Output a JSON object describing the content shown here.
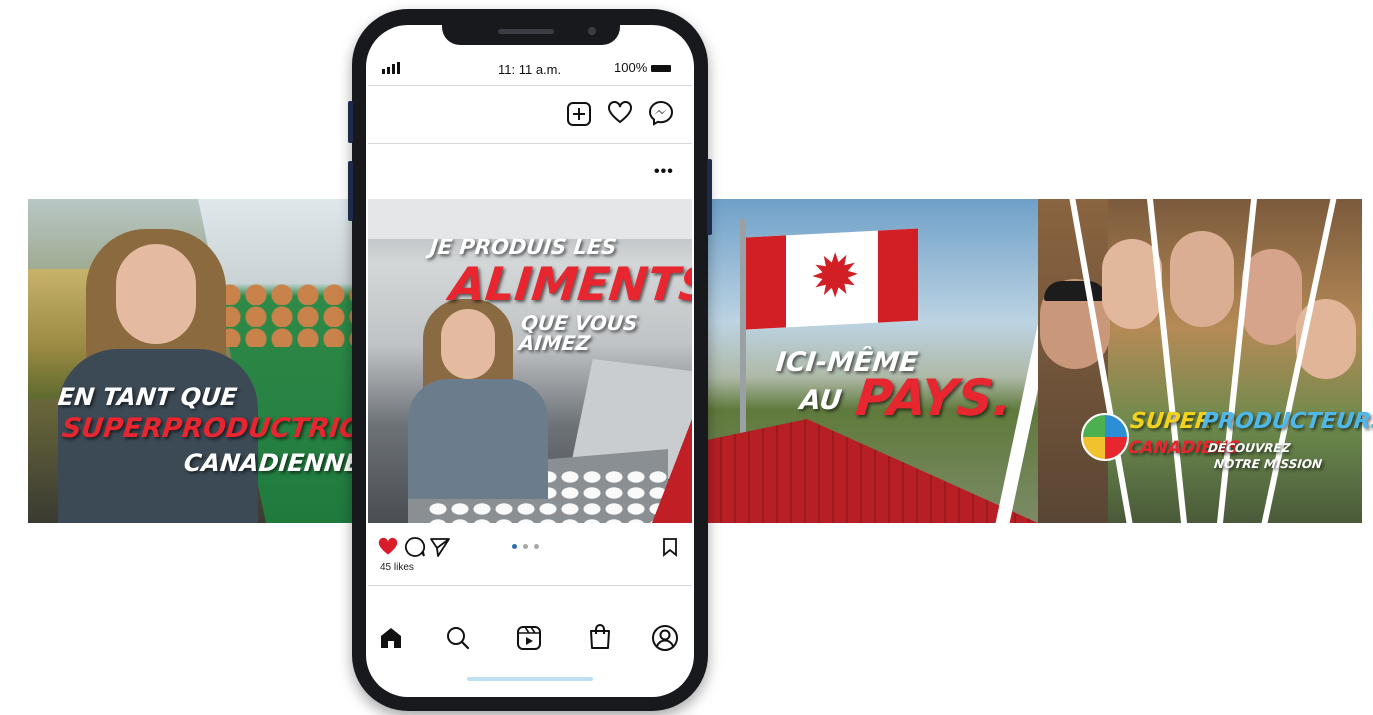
{
  "panels": {
    "left": {
      "line1": "EN TANT QUE",
      "line2": "SUPERPRODUCTRICE",
      "line3": "CANADIENNE"
    },
    "flag": {
      "line1": "ICI-MÊME",
      "line2": "AU",
      "line3": "PAYS."
    },
    "right": {
      "brand1": "SUPER",
      "brand2": "PRODUCTEURS",
      "brand3": "CANADIENS",
      "cta1": "DÉCOUVREZ",
      "cta2": "NOTRE MISSION"
    }
  },
  "phone": {
    "status": {
      "time": "11: 11 a.m.",
      "battery": "100%"
    },
    "top_icons": [
      "plus-square-icon",
      "heart-outline-icon",
      "messenger-icon"
    ],
    "more": "•••",
    "post": {
      "line1": "JE PRODUIS LES",
      "line2": "ALIMENTS",
      "line3": "QUE VOUS AIMEZ"
    },
    "likes": "45 likes",
    "carousel": {
      "count": 3,
      "active": 0
    },
    "nav": [
      "home-icon",
      "search-icon",
      "reels-icon",
      "shop-icon",
      "profile-icon"
    ]
  },
  "colors": {
    "accent_red": "#e8262f",
    "flag_red": "#d21f26",
    "like_red": "#d91c2a",
    "dot_active": "#2a6fb0"
  }
}
